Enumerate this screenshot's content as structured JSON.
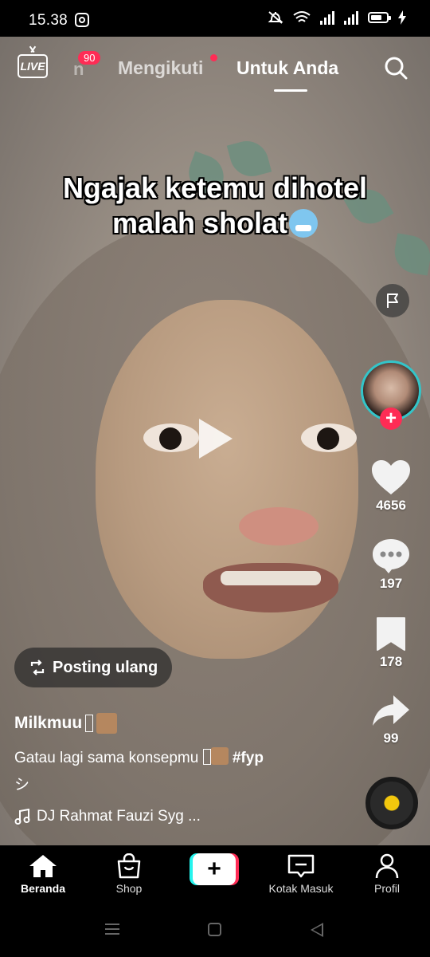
{
  "status_bar": {
    "time": "15.38",
    "instagram_icon": "instagram-icon",
    "icons": [
      "mute-icon",
      "wifi-icon",
      "signal-icon",
      "signal-icon",
      "battery-icon"
    ]
  },
  "top_nav": {
    "live_label": "LIVE",
    "faded_tab": "n",
    "faded_tab_badge": "90",
    "following_tab": "Mengikuti",
    "for_you_tab": "Untuk Anda",
    "active_tab": "Untuk Anda"
  },
  "video": {
    "caption_line1": "Ngajak ketemu dihotel",
    "caption_line2": "malah sholat",
    "caption_emoji": "cold-face-emoji",
    "state": "paused"
  },
  "actions": {
    "likes": "4656",
    "comments": "197",
    "bookmarks": "178",
    "shares": "99"
  },
  "post": {
    "repost_label": "Posting ulang",
    "username": "Milkmuu",
    "description_start": "Gatau lagi sama konsepmu",
    "hashtag": "#fyp",
    "description_end": "シ",
    "music": "DJ Rahmat Fauzi Syg ..."
  },
  "bottom_nav": {
    "home": "Beranda",
    "shop": "Shop",
    "create": "+",
    "inbox": "Kotak Masuk",
    "profile": "Profil",
    "active": "Beranda"
  },
  "colors": {
    "accent_pink": "#fe2c55",
    "accent_cyan": "#25f4ee",
    "avatar_ring": "#33c5c9",
    "disc_center": "#f2c70d"
  }
}
